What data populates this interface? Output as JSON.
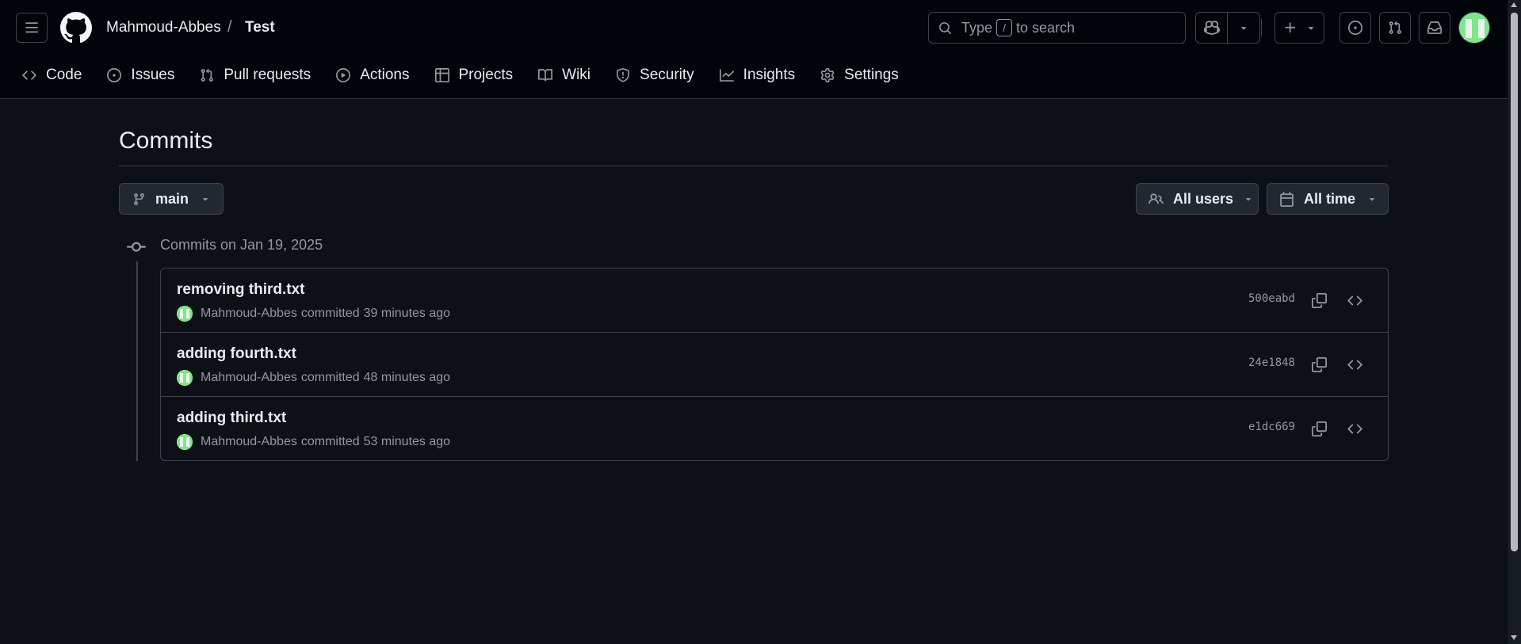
{
  "header": {
    "owner": "Mahmoud-Abbes",
    "separator": "/",
    "repo": "Test",
    "search": {
      "text_before": "Type",
      "key": "/",
      "text_after": "to search"
    }
  },
  "nav": {
    "items": [
      {
        "label": "Code",
        "icon": "code-icon"
      },
      {
        "label": "Issues",
        "icon": "issue-opened-icon"
      },
      {
        "label": "Pull requests",
        "icon": "pull-request-icon"
      },
      {
        "label": "Actions",
        "icon": "play-icon"
      },
      {
        "label": "Projects",
        "icon": "table-icon"
      },
      {
        "label": "Wiki",
        "icon": "book-icon"
      },
      {
        "label": "Security",
        "icon": "shield-icon"
      },
      {
        "label": "Insights",
        "icon": "graph-icon"
      },
      {
        "label": "Settings",
        "icon": "gear-icon"
      }
    ]
  },
  "main": {
    "title": "Commits",
    "branch": "main",
    "users_filter": "All users",
    "time_filter": "All time",
    "group_header": "Commits on Jan 19, 2025",
    "commits": [
      {
        "message": "removing third.txt",
        "author": "Mahmoud-Abbes",
        "verb": "committed",
        "time": "39 minutes ago",
        "sha": "500eabd"
      },
      {
        "message": "adding fourth.txt",
        "author": "Mahmoud-Abbes",
        "verb": "committed",
        "time": "48 minutes ago",
        "sha": "24e1848"
      },
      {
        "message": "adding third.txt",
        "author": "Mahmoud-Abbes",
        "verb": "committed",
        "time": "53 minutes ago",
        "sha": "e1dc669"
      }
    ]
  },
  "colors": {
    "background": "#0d1117",
    "header_background": "#010409",
    "border": "#3d444d",
    "text_primary": "#e6edf3",
    "text_muted": "#9198a1",
    "avatar_green": "#7ee787"
  }
}
